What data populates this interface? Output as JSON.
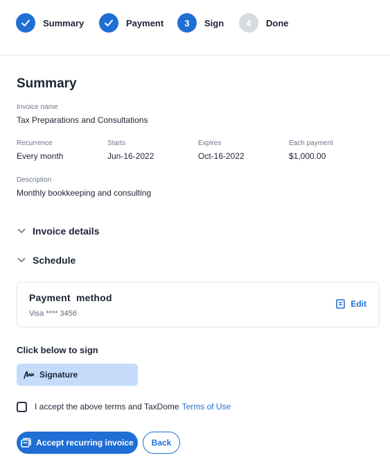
{
  "stepper": {
    "steps": [
      {
        "label": "Summary",
        "state": "done",
        "icon": "check-icon"
      },
      {
        "label": "Payment",
        "state": "done",
        "icon": "check-icon"
      },
      {
        "label": "Sign",
        "state": "active",
        "number": "3"
      },
      {
        "label": "Done",
        "state": "pending",
        "number": "4"
      }
    ]
  },
  "summary": {
    "title": "Summary",
    "invoice_name": {
      "label": "Invoice name",
      "value": "Tax Preparations and Consultations"
    },
    "recurrence": {
      "label": "Recurrence",
      "value": "Every month"
    },
    "starts": {
      "label": "Starts",
      "value": "Jun-16-2022"
    },
    "expires": {
      "label": "Expires",
      "value": "Oct-16-2022"
    },
    "each_payment": {
      "label": "Each payment",
      "value": "$1,000.00"
    },
    "description": {
      "label": "Description",
      "value": "Monthly bookkeeping and consulting"
    }
  },
  "sections": {
    "invoice_details": "Invoice details",
    "schedule": "Schedule"
  },
  "payment_method": {
    "title": "Payment  method",
    "value": "Visa **** 3456",
    "edit_label": "Edit",
    "edit_icon": "edit-icon"
  },
  "sign": {
    "title": "Click below to sign",
    "signature_label": "Signature",
    "signature_icon": "signature-icon"
  },
  "terms": {
    "text": "I accept the above terms and TaxDome",
    "link": "Terms of Use"
  },
  "actions": {
    "accept_label": "Accept recurring invoice",
    "back_label": "Back"
  },
  "colors": {
    "accent": "#1f6ed4",
    "signature_bg": "#c4dcfa",
    "pending_step": "#d6dbe2"
  }
}
